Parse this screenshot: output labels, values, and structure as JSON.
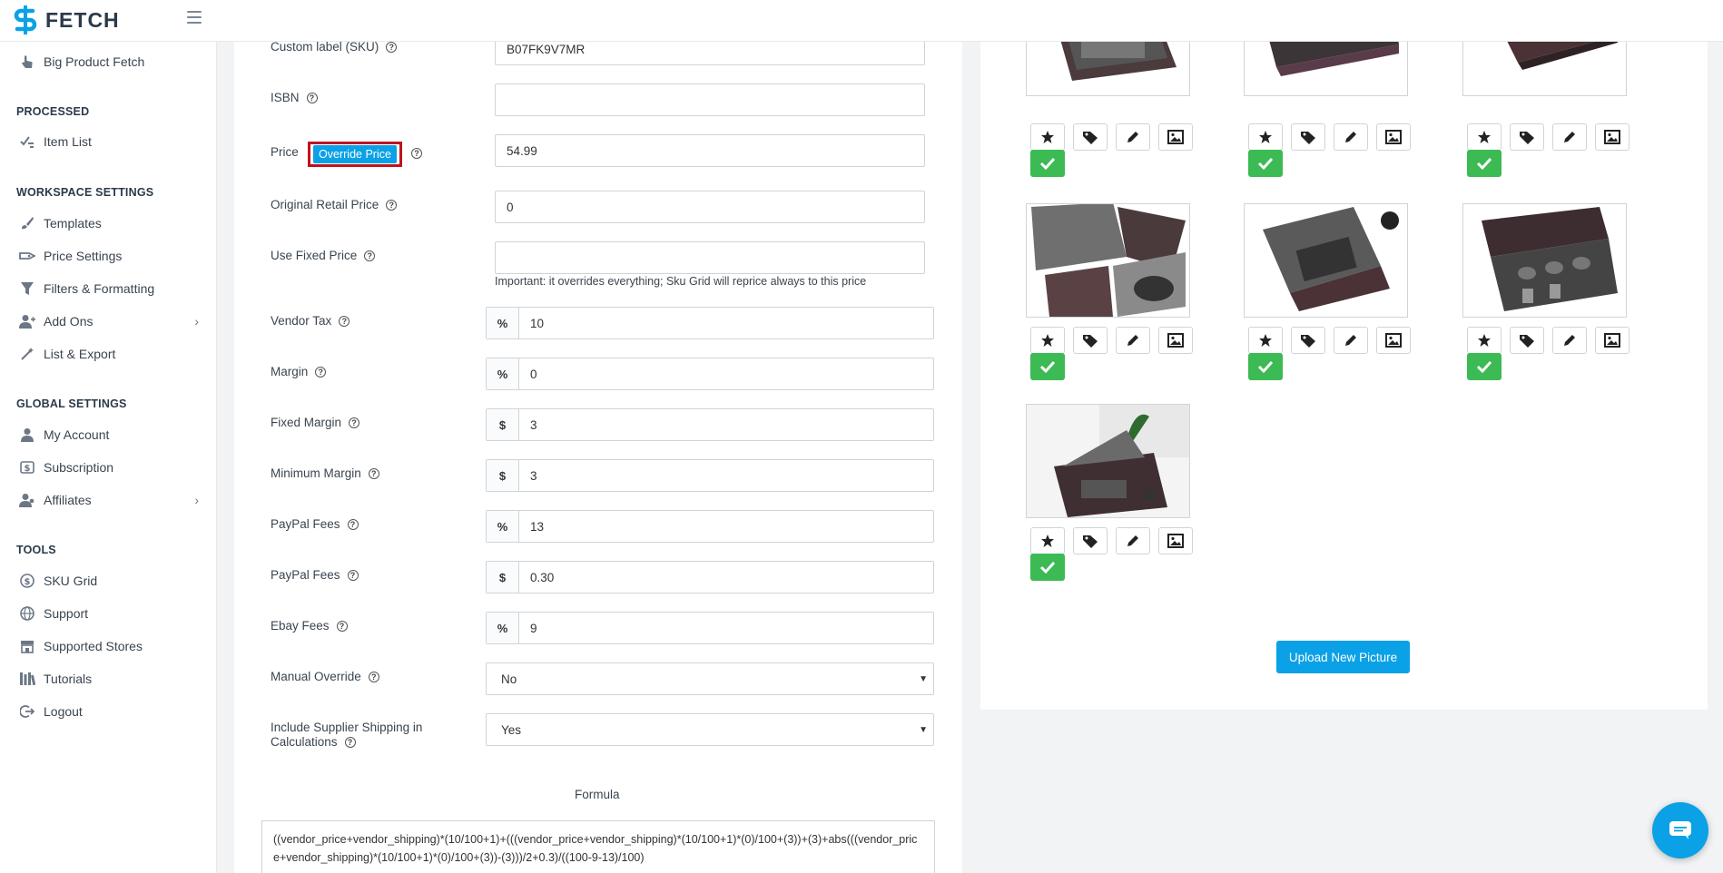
{
  "brand": {
    "name": "FETCH"
  },
  "sidebar": {
    "top_item": {
      "label": "Big Product Fetch",
      "icon": "hand-pointer-icon"
    },
    "sections": [
      {
        "heading": "PROCESSED",
        "items": [
          {
            "label": "Item List",
            "icon": "checklist-icon"
          }
        ]
      },
      {
        "heading": "WORKSPACE SETTINGS",
        "items": [
          {
            "label": "Templates",
            "icon": "brush-icon"
          },
          {
            "label": "Price Settings",
            "icon": "tag-icon"
          },
          {
            "label": "Filters & Formatting",
            "icon": "filter-icon"
          },
          {
            "label": "Add Ons",
            "icon": "user-plus-icon"
          },
          {
            "label": "List & Export",
            "icon": "magic-wand-icon"
          }
        ]
      },
      {
        "heading": "GLOBAL SETTINGS",
        "items": [
          {
            "label": "My Account",
            "icon": "user-icon"
          },
          {
            "label": "Subscription",
            "icon": "dollar-card-icon"
          },
          {
            "label": "Affiliates",
            "icon": "user-group-icon"
          }
        ]
      },
      {
        "heading": "TOOLS",
        "items": [
          {
            "label": "SKU Grid",
            "icon": "dollar-icon"
          },
          {
            "label": "Support",
            "icon": "globe-icon"
          },
          {
            "label": "Supported Stores",
            "icon": "store-icon"
          },
          {
            "label": "Tutorials",
            "icon": "books-icon"
          },
          {
            "label": "Logout",
            "icon": "logout-icon"
          }
        ]
      }
    ]
  },
  "form": {
    "custom_label": {
      "label": "Custom label (SKU)",
      "value": "B07FK9V7MR"
    },
    "isbn": {
      "label": "ISBN",
      "value": ""
    },
    "price": {
      "label": "Price",
      "button": "Override Price",
      "value": "54.99"
    },
    "original_retail": {
      "label": "Original Retail Price",
      "value": "0"
    },
    "fixed_price": {
      "label": "Use Fixed Price",
      "value": "",
      "note": "Important: it overrides everything; Sku Grid will reprice always to this price"
    },
    "vendor_tax": {
      "label": "Vendor Tax",
      "addon": "%",
      "value": "10"
    },
    "margin": {
      "label": "Margin",
      "addon": "%",
      "value": "0"
    },
    "fixed_margin": {
      "label": "Fixed Margin",
      "addon": "$",
      "value": "3"
    },
    "minimum_margin": {
      "label": "Minimum Margin",
      "addon": "$",
      "value": "3"
    },
    "paypal_fees_pct": {
      "label": "PayPal Fees",
      "addon": "%",
      "value": "13"
    },
    "paypal_fees_fixed": {
      "label": "PayPal Fees",
      "addon": "$",
      "value": "0.30"
    },
    "ebay_fees": {
      "label": "Ebay Fees",
      "addon": "%",
      "value": "9"
    },
    "manual_override": {
      "label": "Manual Override",
      "value": "No"
    },
    "include_shipping": {
      "label_line1": "Include Supplier Shipping in",
      "label_line2": "Calculations",
      "value": "Yes"
    },
    "formula": {
      "label": "Formula",
      "value": "((vendor_price+vendor_shipping)*(10/100+1)+(((vendor_price+vendor_shipping)*(10/100+1)*(0)/100+(3))+(3)+abs(((vendor_price+vendor_shipping)*(10/100+1)*(0)/100+(3))-(3)))/2+0.3)/((100-9-13)/100)"
    }
  },
  "pictures": {
    "upload_label": "Upload New Picture",
    "count": 7
  },
  "colors": {
    "accent": "#0aa1e6",
    "success": "#3cba54",
    "highlight": "#c1121f"
  }
}
